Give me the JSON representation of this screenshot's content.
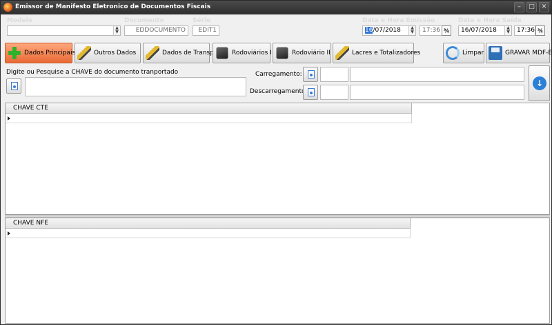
{
  "window": {
    "title": "Emissor de Manifesto Eletronico de Documentos Fiscais",
    "controls": {
      "minimize": "–",
      "maximize": "□",
      "close": "✕"
    }
  },
  "header": {
    "modelo_label": "Modelo",
    "modelo_value": "",
    "documento_label": "Documento",
    "documento_value": "EDDOCUMENTO",
    "serie_label": "Série",
    "serie_value": "EDIT1",
    "emissao_label": "Data e Hora Emissão",
    "emissao_day": "16",
    "emissao_date_rest": "/07/2018",
    "emissao_time": "17:36",
    "saida_label": "Data e Hora Saída",
    "saida_date": "16/07/2018",
    "saida_time": "17:36",
    "calendar_glyph": "¾",
    "spin_up": "▲",
    "spin_down": "▼"
  },
  "toolbar": {
    "tabs": [
      {
        "label": "Dados Principais",
        "icon": "plus-icon",
        "active": true
      },
      {
        "label": "Outros Dados",
        "icon": "pen-icon"
      },
      {
        "label": "Dados de Transp.",
        "icon": "pen-icon"
      },
      {
        "label": "Rodoviários I",
        "icon": "cube-icon"
      },
      {
        "label": "Rodoviário II",
        "icon": "cube-icon"
      },
      {
        "label": "Lacres e Totalizadores",
        "icon": "pen-icon"
      }
    ],
    "limpar_label": "Limpar",
    "gravar_label": "GRAVAR MDF-E"
  },
  "key_section": {
    "prompt": "Digite ou Pesquise a CHAVE do documento tranportado",
    "carregamento_label": "Carregamento:",
    "descarregamento_label": "Descarregamento:",
    "arrow_glyph": "↓"
  },
  "grids": {
    "cte_header": "CHAVE CTE",
    "nfe_header": "CHAVE NFE"
  }
}
